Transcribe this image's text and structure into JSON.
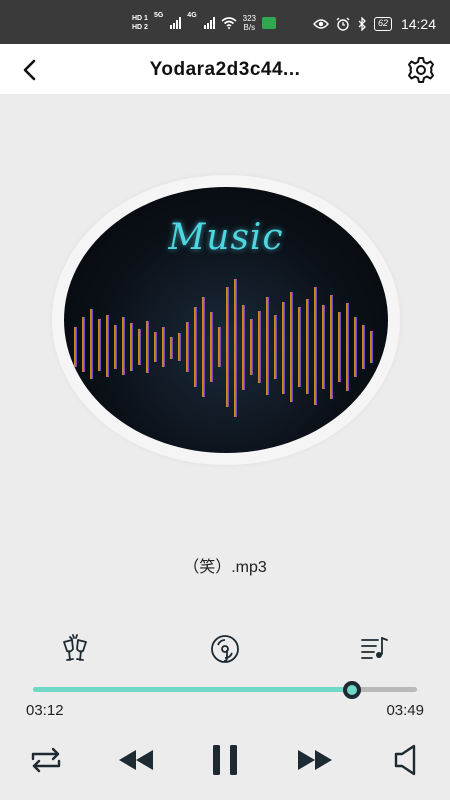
{
  "status_bar": {
    "hd1": "HD 1",
    "hd2": "HD 2",
    "net1": "5G",
    "net2": "4G",
    "speed_value": "323",
    "speed_unit": "B/s",
    "battery": "62",
    "time": "14:24"
  },
  "header": {
    "title": "Yodara2d3c44..."
  },
  "album": {
    "art_text": "Music"
  },
  "song": {
    "name": "（笑）.mp3"
  },
  "player": {
    "current_time": "03:12",
    "total_time": "03:49",
    "progress": 0.83
  },
  "colors": {
    "accent": "#6fd8c6",
    "track": "#b9b9b9",
    "status_bar": "#3a3a3a",
    "icon": "#1e2a32"
  }
}
